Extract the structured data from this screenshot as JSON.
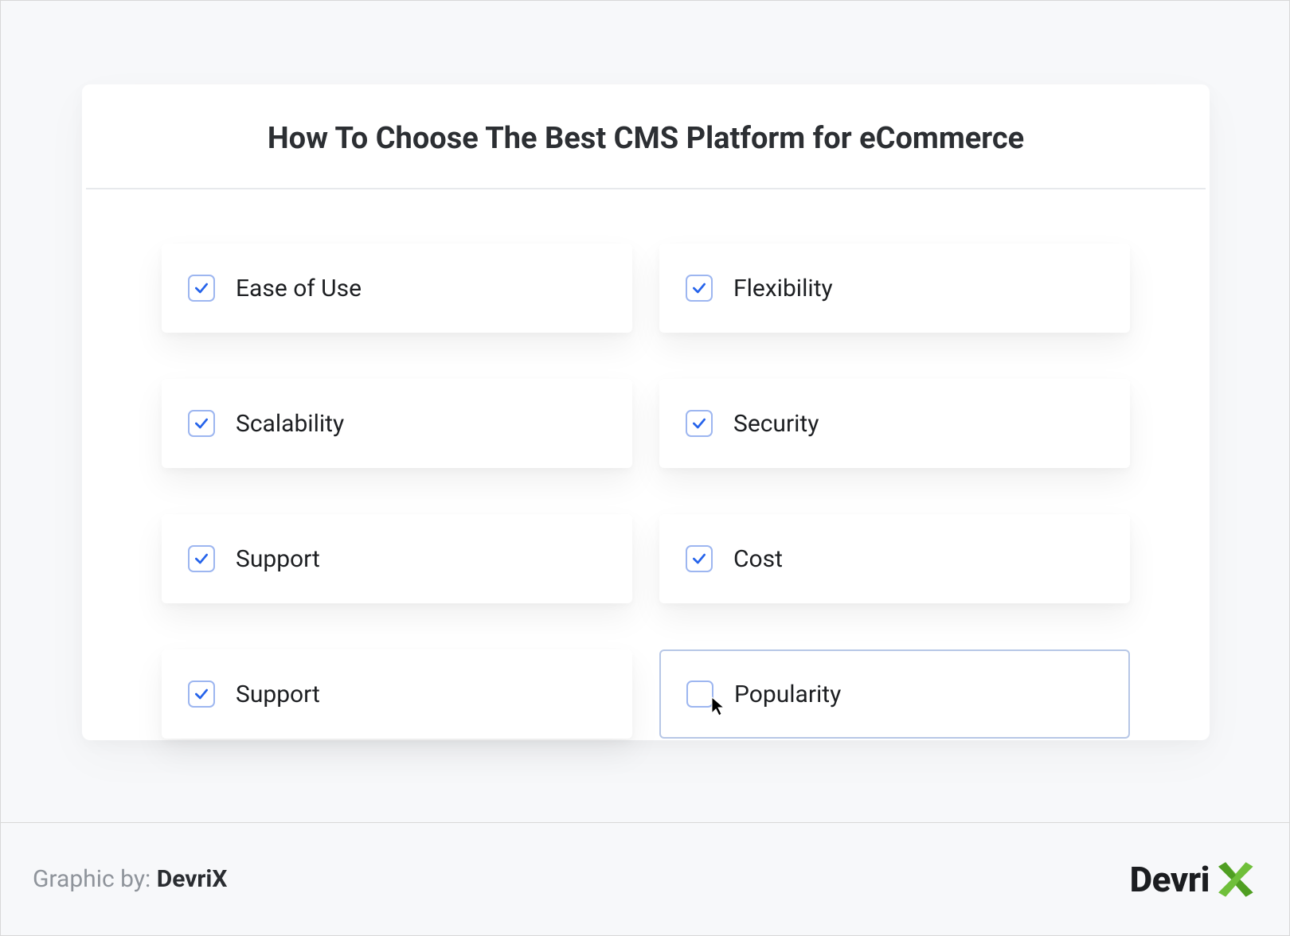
{
  "title": "How To Choose The Best CMS Platform for eCommerce",
  "items": [
    {
      "label": "Ease of Use",
      "checked": true,
      "active": false
    },
    {
      "label": "Flexibility",
      "checked": true,
      "active": false
    },
    {
      "label": "Scalability",
      "checked": true,
      "active": false
    },
    {
      "label": "Security",
      "checked": true,
      "active": false
    },
    {
      "label": "Support",
      "checked": true,
      "active": false
    },
    {
      "label": "Cost",
      "checked": true,
      "active": false
    },
    {
      "label": "Support",
      "checked": true,
      "active": false
    },
    {
      "label": "Popularity",
      "checked": false,
      "active": true
    }
  ],
  "footer": {
    "credit_prefix": "Graphic by: ",
    "brand": "DevriX",
    "logo_text": "Devri"
  }
}
